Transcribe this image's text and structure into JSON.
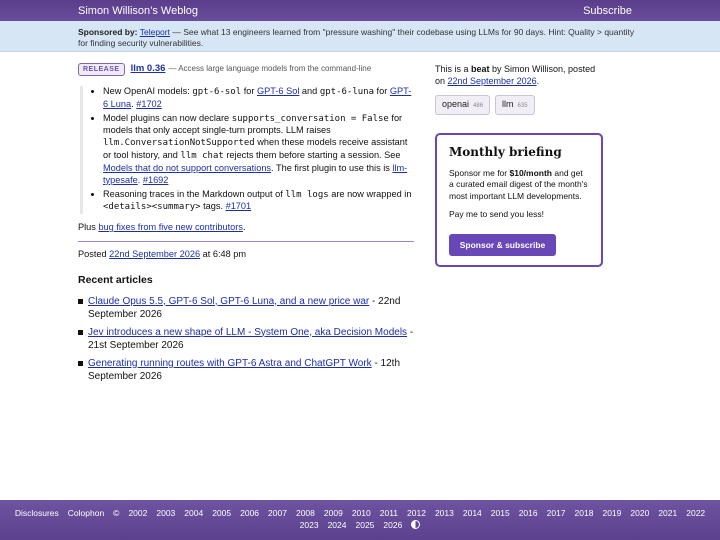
{
  "header": {
    "site_title": "Simon Willison’s Weblog",
    "subscribe": "Subscribe"
  },
  "sponsor": {
    "label": "Sponsored by:",
    "sponsor_name": "Teleport",
    "text": " — See what 13 engineers learned from \"pressure washing\" their codebase using LLMs for 90 days. Hint: Quality > quantity for finding security vulnerabilities."
  },
  "beat": {
    "badge": "RELEASE",
    "title": "llm 0.36",
    "description": " — Access large language models from the command-line"
  },
  "notes": [
    {
      "parts": [
        "New OpenAI models: ",
        "gpt-6-sol",
        " for ",
        "GPT-6 Sol",
        " and ",
        "gpt-6-luna",
        " for ",
        "GPT-6 Luna",
        ". ",
        "#1702"
      ]
    },
    {
      "parts": [
        "Model plugins can now declare ",
        "supports_conversation = False",
        " for models that only accept single-turn prompts. LLM raises ",
        "llm.ConversationNotSupported",
        " when these models receive assistant or tool history, and ",
        "llm chat",
        " rejects them before starting a session. See ",
        "Models that do not support conversations",
        ". The first plugin to use this is ",
        "llm-typesafe",
        ". ",
        "#1692"
      ]
    },
    {
      "parts": [
        "Reasoning traces in the Markdown output of ",
        "llm logs",
        " are now wrapped in ",
        "<details><summary>",
        " tags. ",
        "#1701"
      ]
    }
  ],
  "plus": {
    "prefix": "Plus ",
    "link": "bug fixes from five new contributors",
    "suffix": "."
  },
  "posted": {
    "prefix": "Posted ",
    "date": "22nd September 2026",
    "suffix": " at 6:48 pm"
  },
  "recent": {
    "title": "Recent articles",
    "items": [
      {
        "title": "Claude Opus 5.5, GPT-6 Sol, GPT-6 Luna, and a new price war",
        "date": " - 22nd September 2026"
      },
      {
        "title": "Jev introduces a new shape of LLM - System One, aka Decision Models",
        "date": " - 21st September 2026"
      },
      {
        "title": "Generating running routes with GPT-6 Astra and ChatGPT Work",
        "date": " - 12th September 2026"
      }
    ]
  },
  "sidebar": {
    "meta_prefix": "This is a ",
    "meta_beat": "beat",
    "meta_middle": " by Simon Willison, posted on ",
    "meta_date": "22nd September 2026",
    "meta_suffix": ".",
    "tags": [
      {
        "name": "openai",
        "count": "486"
      },
      {
        "name": "llm",
        "count": "635"
      }
    ]
  },
  "briefing": {
    "title": "Monthly briefing",
    "text_prefix": "Sponsor me for ",
    "price": "$10/month",
    "text_suffix": " and get a curated email digest of the month's most important LLM developments.",
    "pay": "Pay me to send you less!",
    "button": "Sponsor & subscribe"
  },
  "footer": {
    "links": [
      "Disclosures",
      "Colophon",
      "©"
    ],
    "years_row1": [
      "2002",
      "2003",
      "2004",
      "2005",
      "2006",
      "2007",
      "2008",
      "2009",
      "2010",
      "2011",
      "2012",
      "2013",
      "2014",
      "2015",
      "2016",
      "2017",
      "2018",
      "2019",
      "2020",
      "2021",
      "2022"
    ],
    "years_row2": [
      "2023",
      "2024",
      "2025",
      "2026"
    ]
  },
  "colors": {
    "header_bg": "#5a3e8a",
    "accent": "#6748b6",
    "sponsor_bg": "#d6e6f4",
    "link": "#1c2fa6"
  }
}
